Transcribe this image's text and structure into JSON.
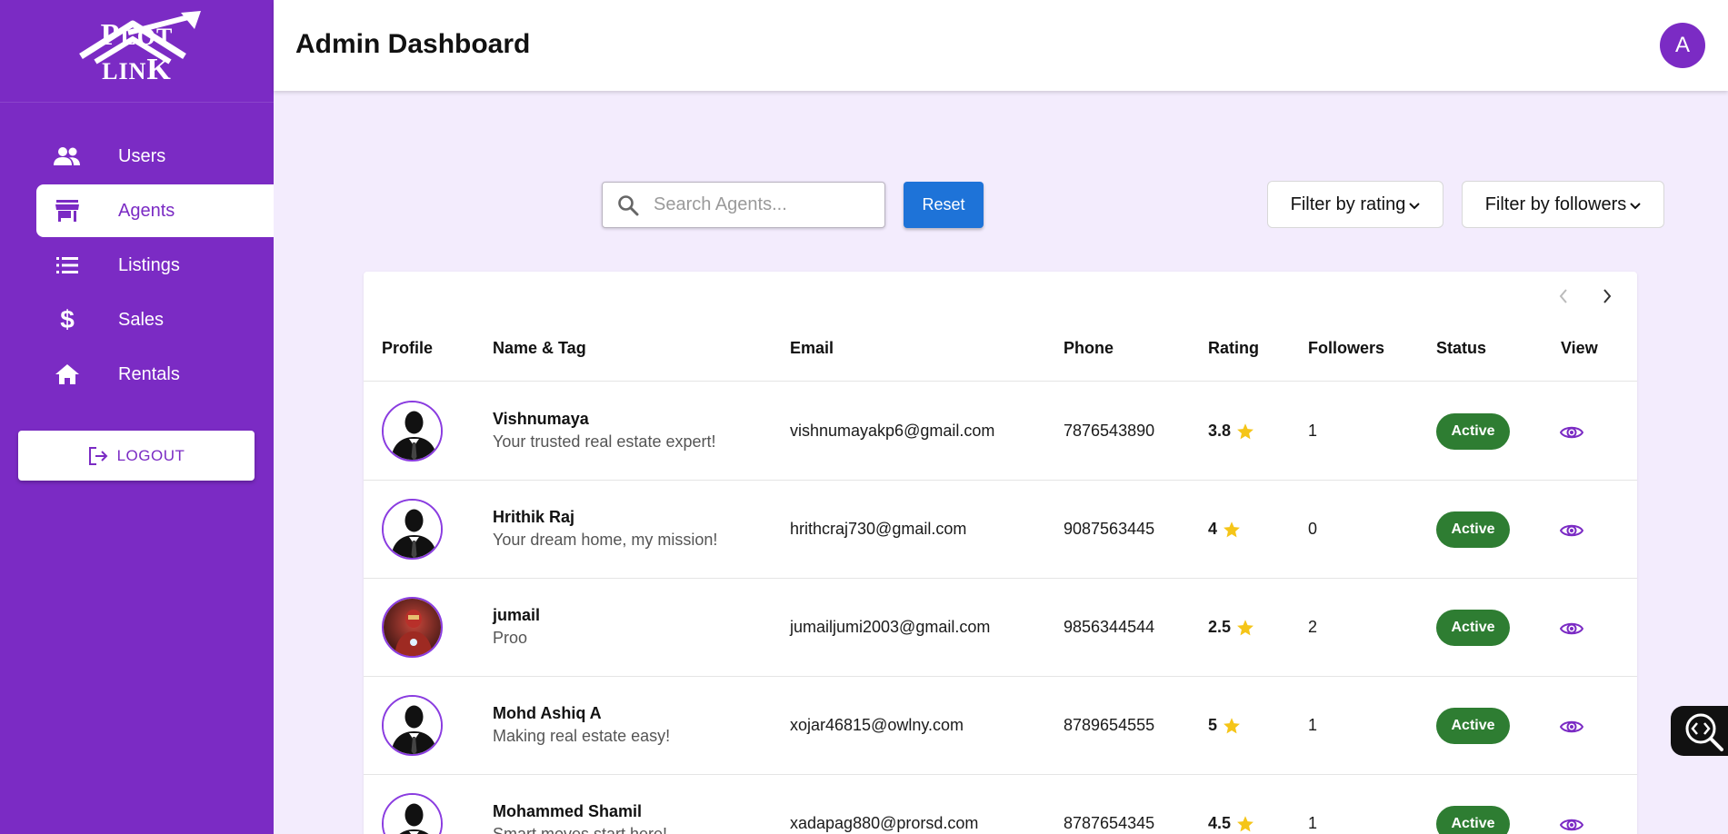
{
  "brand": {
    "logo_text_big": "P",
    "logo_text_small": "LOT LIN",
    "logo_text_end": "K"
  },
  "sidebar": {
    "items": [
      {
        "label": "Users",
        "icon": "users-icon",
        "active": false
      },
      {
        "label": "Agents",
        "icon": "store-icon",
        "active": true
      },
      {
        "label": "Listings",
        "icon": "list-icon",
        "active": false
      },
      {
        "label": "Sales",
        "icon": "dollar-icon",
        "active": false
      },
      {
        "label": "Rentals",
        "icon": "home-icon",
        "active": false
      }
    ],
    "logout_label": "LOGOUT"
  },
  "header": {
    "title": "Admin Dashboard",
    "avatar_initial": "A"
  },
  "toolbar": {
    "search_placeholder": "Search Agents...",
    "reset_label": "Reset",
    "filter_rating_label": "Filter by rating",
    "filter_followers_label": "Filter by followers"
  },
  "table": {
    "columns": [
      "Profile",
      "Name & Tag",
      "Email",
      "Phone",
      "Rating",
      "Followers",
      "Status",
      "View"
    ],
    "rows": [
      {
        "name": "Vishnumaya",
        "tag": "Your trusted real estate expert!",
        "email": "vishnumayakp6@gmail.com",
        "phone": "7876543890",
        "rating": "3.8",
        "followers": "1",
        "status": "Active",
        "avatar": "silhouette"
      },
      {
        "name": "Hrithik Raj",
        "tag": "Your dream home, my mission!",
        "email": "hrithcraj730@gmail.com",
        "phone": "9087563445",
        "rating": "4",
        "followers": "0",
        "status": "Active",
        "avatar": "silhouette"
      },
      {
        "name": "jumail",
        "tag": "Proo",
        "email": "jumailjumi2003@gmail.com",
        "phone": "9856344544",
        "rating": "2.5",
        "followers": "2",
        "status": "Active",
        "avatar": "photo"
      },
      {
        "name": "Mohd Ashiq A",
        "tag": "Making real estate easy!",
        "email": "xojar46815@owlny.com",
        "phone": "8789654555",
        "rating": "5",
        "followers": "1",
        "status": "Active",
        "avatar": "silhouette"
      },
      {
        "name": "Mohammed Shamil",
        "tag": "Smart moves start here!",
        "email": "xadapag880@prorsd.com",
        "phone": "8787654345",
        "rating": "4.5",
        "followers": "1",
        "status": "Active",
        "avatar": "silhouette"
      }
    ]
  },
  "colors": {
    "brand": "#7b2bc4",
    "accent_blue": "#1e73d8",
    "status_active": "#2e7d32",
    "star": "#f5c518",
    "page_bg": "#f3ecfd"
  }
}
